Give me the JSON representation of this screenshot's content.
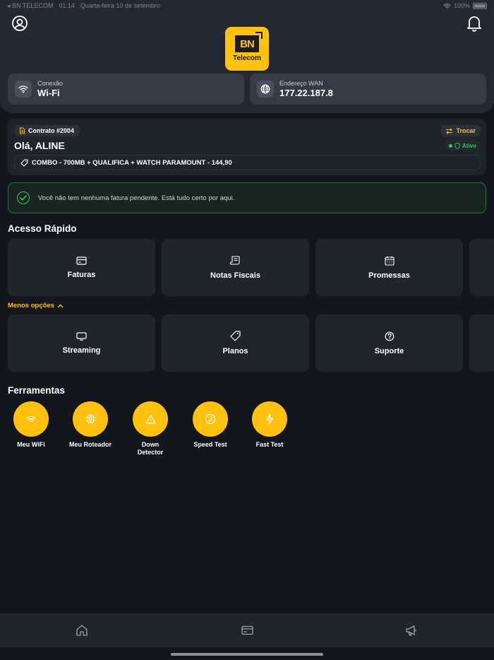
{
  "status_bar": {
    "carrier": "◂ BN TELECOM",
    "time": "01:14",
    "date": "Quarta-feira 10 de setembro",
    "battery": "100%",
    "battery_level": 1.0
  },
  "header": {
    "logo_text": "Telecom",
    "logo_mark": "BN",
    "connection": {
      "label": "Conexão",
      "value": "Wi-Fi"
    },
    "wan": {
      "label": "Endereço WAN",
      "value": "177.22.187.8"
    }
  },
  "contract": {
    "number": "Contrato #2004",
    "switch_label": "Trocar",
    "greeting": "Olá, ALINE",
    "status": "Ativo",
    "plan": "COMBO - 700MB + QUALIFICA + WATCH PARAMOUNT - 144,90"
  },
  "alert": {
    "message": "Você não tem nenhuma fatura pendente. Está tudo certo por aqui."
  },
  "quick_access": {
    "title": "Acesso Rápido",
    "row1": [
      {
        "label": "Faturas",
        "icon": "credit-card-icon"
      },
      {
        "label": "Notas Fiscais",
        "icon": "receipt-icon"
      },
      {
        "label": "Promessas",
        "icon": "calendar-icon"
      }
    ],
    "less_options": "Menos opções",
    "row2": [
      {
        "label": "Streaming",
        "icon": "tv-icon"
      },
      {
        "label": "Planos",
        "icon": "tag-icon"
      },
      {
        "label": "Suporte",
        "icon": "help-circle-icon"
      }
    ]
  },
  "tools": {
    "title": "Ferramentas",
    "items": [
      {
        "label": "Meu WiFi",
        "icon": "wifi-icon"
      },
      {
        "label": "Meu Roteador",
        "icon": "chip-icon"
      },
      {
        "label": "Down Detector",
        "icon": "warning-icon"
      },
      {
        "label": "Speed Test",
        "icon": "gauge-icon"
      },
      {
        "label": "Fast Test",
        "icon": "lightning-icon"
      }
    ]
  },
  "bottom_nav": [
    "home-icon",
    "credit-card-icon",
    "megaphone-icon"
  ],
  "colors": {
    "accent": "#ffc10e",
    "background": "#13161c",
    "card": "#20242b",
    "success": "#3cc45f"
  }
}
